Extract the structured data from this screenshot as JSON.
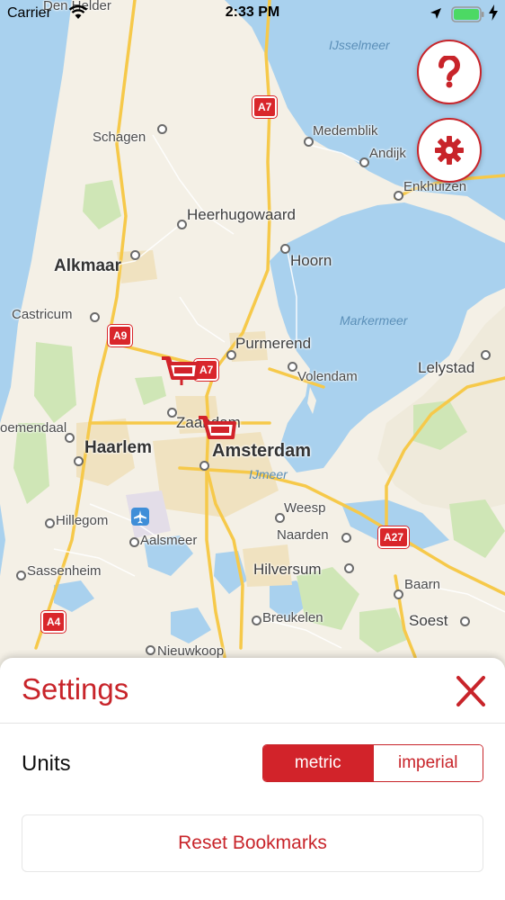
{
  "status_bar": {
    "carrier": "Carrier",
    "time": "2:33 PM"
  },
  "map": {
    "water_labels": {
      "ijsselmeer": "IJsselmeer",
      "markermeer": "Markermeer",
      "ijmeer": "IJmeer"
    },
    "places": {
      "den_helder": "Den Helder",
      "schagen": "Schagen",
      "medemblik": "Medemblik",
      "andijk": "Andijk",
      "enkhuizen": "Enkhuizen",
      "heerhugowaard": "Heerhugowaard",
      "alkmaar": "Alkmaar",
      "hoorn": "Hoorn",
      "castricum": "Castricum",
      "purmerend": "Purmerend",
      "volendam": "Volendam",
      "lelystad": "Lelystad",
      "bloemendaal": "oemendaal",
      "haarlem": "Haarlem",
      "zaandam": "Zaandam",
      "amsterdam": "Amsterdam",
      "hillegom": "Hillegom",
      "weesp": "Weesp",
      "aalsmeer": "Aalsmeer",
      "naarden": "Naarden",
      "sassenheim": "Sassenheim",
      "hilversum": "Hilversum",
      "baarn": "Baarn",
      "soest": "Soest",
      "breukelen": "Breukelen",
      "nieuwkoop": "Nieuwkoop"
    },
    "road_shields": {
      "a7_north": "A7",
      "a9": "A9",
      "a7_south": "A7",
      "a27": "A27",
      "a4": "A4"
    }
  },
  "buttons": {
    "help": "help-icon",
    "settings": "gear-icon"
  },
  "settings_sheet": {
    "title": "Settings",
    "units_label": "Units",
    "units_options": [
      "metric",
      "imperial"
    ],
    "units_selected": "metric",
    "reset_label": "Reset Bookmarks"
  },
  "colors": {
    "accent": "#c8242a",
    "selected_segment": "#d2232a",
    "water": "#a9d1ee",
    "land": "#f4f0e6",
    "road_major": "#f6c94a"
  }
}
